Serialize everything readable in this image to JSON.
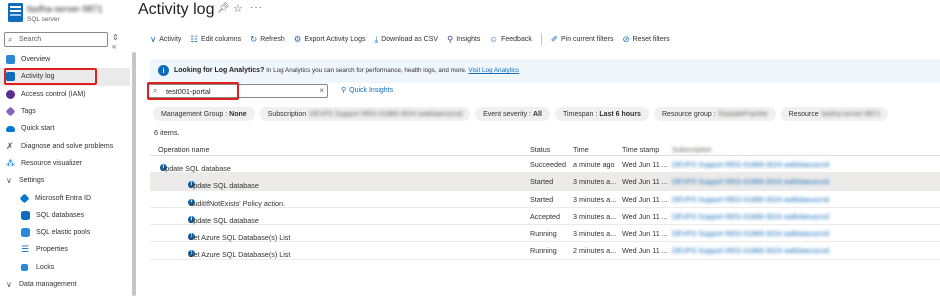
{
  "header": {
    "resource_name": "fasfha-server-9871",
    "resource_type": "SQL server",
    "page_title": "Activity log"
  },
  "sidebar": {
    "search_placeholder": "Search",
    "controls": "⇕ «",
    "items": [
      {
        "label": "Overview",
        "color": "#2b88d8",
        "level": 0
      },
      {
        "label": "Activity log",
        "color": "#0f6cbd",
        "level": 0,
        "active": true
      },
      {
        "label": "Access control (IAM)",
        "color": "#5c2d91",
        "level": 0
      },
      {
        "label": "Tags",
        "color": "#8764b8",
        "level": 0
      },
      {
        "label": "Quick start",
        "color": "#0078d4",
        "level": 0
      },
      {
        "label": "Diagnose and solve problems",
        "color": "#605e5c",
        "level": 0
      },
      {
        "label": "Resource visualizer",
        "color": "#0078d4",
        "level": 0
      },
      {
        "label": "Settings",
        "level": 0,
        "group": true,
        "expanded": true
      },
      {
        "label": "Microsoft Entra ID",
        "color": "#0078d4",
        "level": 1
      },
      {
        "label": "SQL databases",
        "color": "#0f6cbd",
        "level": 1
      },
      {
        "label": "SQL elastic pools",
        "color": "#2b88d8",
        "level": 1
      },
      {
        "label": "Properties",
        "color": "#0f6cbd",
        "level": 1
      },
      {
        "label": "Locks",
        "color": "#2b88d8",
        "level": 1
      },
      {
        "label": "Data management",
        "level": 0,
        "group": true,
        "expanded": true
      }
    ]
  },
  "toolbar": {
    "activity": "Activity",
    "edit_columns": "Edit columns",
    "refresh": "Refresh",
    "export_logs": "Export Activity Logs",
    "download_csv": "Download as CSV",
    "insights": "Insights",
    "feedback": "Feedback",
    "pin_filters": "Pin current filters",
    "reset_filters": "Reset filters"
  },
  "banner": {
    "title": "Looking for Log Analytics?",
    "text": "In Log Analytics you can search for performance, health logs, and more.",
    "link": "Visit Log Analytics"
  },
  "filter": {
    "search_value": "test001-portal",
    "quick_insights": "Quick Insights"
  },
  "chips": {
    "mgmt_label": "Management Group :",
    "mgmt_value": "None",
    "sub_label": "Subscription",
    "sub_value": "DEVPS Support REG-01889-3024 wallolaeuscnd",
    "sev_label": "Event severity :",
    "sev_value": "All",
    "time_label": "Timespan :",
    "time_value": "Last 6 hours",
    "rg_label": "Resource group :",
    "rg_value": "ElastalePracthe",
    "res_label": "Resource",
    "res_value": "fasfha-server-9871"
  },
  "table": {
    "count": "6 items.",
    "headers": {
      "operation": "Operation name",
      "status": "Status",
      "time": "Time",
      "timestamp": "Time stamp",
      "subscription": "Subscription"
    },
    "rows": [
      {
        "operation": "Update SQL database",
        "status": "Succeeded",
        "time": "a minute ago",
        "timestamp": "Wed Jun 11 ...",
        "subscription": "DEVPS Support REG-01889-3024 wallolaeuscnd",
        "group": true
      },
      {
        "operation": "Update SQL database",
        "status": "Started",
        "time": "3 minutes a...",
        "timestamp": "Wed Jun 11 ...",
        "subscription": "DEVPS Support REG-01889-3024 wallolaeuscnd",
        "selected": true
      },
      {
        "operation": "'auditIfNotExists' Policy action.",
        "status": "Started",
        "time": "3 minutes a...",
        "timestamp": "Wed Jun 11 ...",
        "subscription": "DEVPS Support REG-01889-3024 wallolaeuscnd"
      },
      {
        "operation": "Update SQL database",
        "status": "Accepted",
        "time": "3 minutes a...",
        "timestamp": "Wed Jun 11 ...",
        "subscription": "DEVPS Support REG-01889-3024 wallolaeuscnd"
      },
      {
        "operation": "Get Azure SQL Database(s) List",
        "status": "Running",
        "time": "3 minutes a...",
        "timestamp": "Wed Jun 11 ...",
        "subscription": "DEVPS Support REG-01889-3024 wallolaeuscnd"
      },
      {
        "operation": "Get Azure SQL Database(s) List",
        "status": "Running",
        "time": "2 minutes a...",
        "timestamp": "Wed Jun 11 ...",
        "subscription": "DEVPS Support REG-01889-3024 wallolaeuscnd"
      }
    ]
  },
  "colors": {
    "accent": "#0f6cbd",
    "highlight": "#e02020",
    "banner_bg": "#eff6fc"
  }
}
